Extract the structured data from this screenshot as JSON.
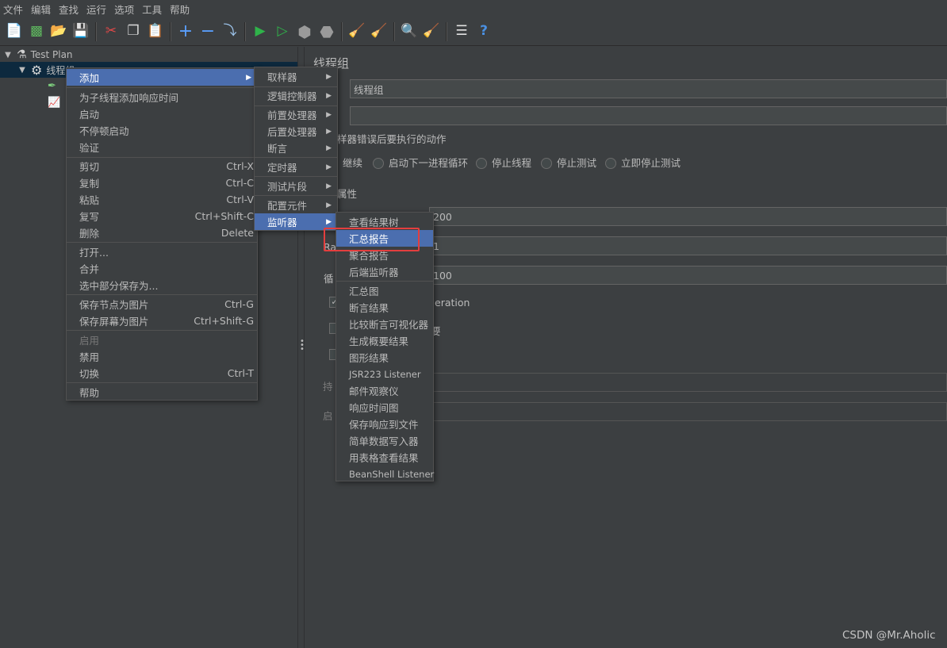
{
  "menubar": [
    "文件",
    "编辑",
    "查找",
    "运行",
    "选项",
    "工具",
    "帮助"
  ],
  "tree": {
    "root": "Test Plan",
    "thread_group": "线程组"
  },
  "panel": {
    "title": "线程组",
    "name_value": "线程组",
    "comment_value": "",
    "error_action_label": "样器错误后要执行的动作",
    "radios": [
      "继续",
      "启动下一进程循环",
      "停止线程",
      "停止测试",
      "立即停止测试"
    ],
    "props_label": "属性",
    "num_threads_value": "200",
    "ramp_label": "Ra",
    "ramp_value": "1",
    "loop_label": "循",
    "loop_value": "100",
    "same_user_fragment": "eration",
    "delay_fragment": "要",
    "duration_label": "持",
    "startup_label": "启"
  },
  "context_menu": {
    "add": "添加",
    "add_response_time": "为子线程添加响应时间",
    "start": "启动",
    "start_no_pause": "不停顿启动",
    "validate": "验证",
    "cut": "剪切",
    "cut_sc": "Ctrl-X",
    "copy": "复制",
    "copy_sc": "Ctrl-C",
    "paste": "粘贴",
    "paste_sc": "Ctrl-V",
    "duplicate": "复写",
    "duplicate_sc": "Ctrl+Shift-C",
    "delete": "删除",
    "delete_sc": "Delete",
    "open": "打开...",
    "merge": "合并",
    "save_selection": "选中部分保存为...",
    "save_node_img": "保存节点为图片",
    "save_node_img_sc": "Ctrl-G",
    "save_screen_img": "保存屏幕为图片",
    "save_screen_img_sc": "Ctrl+Shift-G",
    "enable": "启用",
    "disable": "禁用",
    "toggle": "切换",
    "toggle_sc": "Ctrl-T",
    "help": "帮助"
  },
  "add_submenu": [
    "取样器",
    "逻辑控制器",
    "前置处理器",
    "后置处理器",
    "断言",
    "定时器",
    "测试片段",
    "配置元件",
    "监听器"
  ],
  "listener_submenu": [
    "查看结果树",
    "汇总报告",
    "聚合报告",
    "后端监听器",
    "汇总图",
    "断言结果",
    "比较断言可视化器",
    "生成概要结果",
    "图形结果",
    "JSR223 Listener",
    "邮件观察仪",
    "响应时间图",
    "保存响应到文件",
    "简单数据写入器",
    "用表格查看结果",
    "BeanShell Listener"
  ],
  "watermark": "CSDN @Mr.Aholic",
  "colors": {
    "highlight": "#4b6eaf",
    "background": "#3c3f41",
    "annotation": "#e33e3e"
  }
}
